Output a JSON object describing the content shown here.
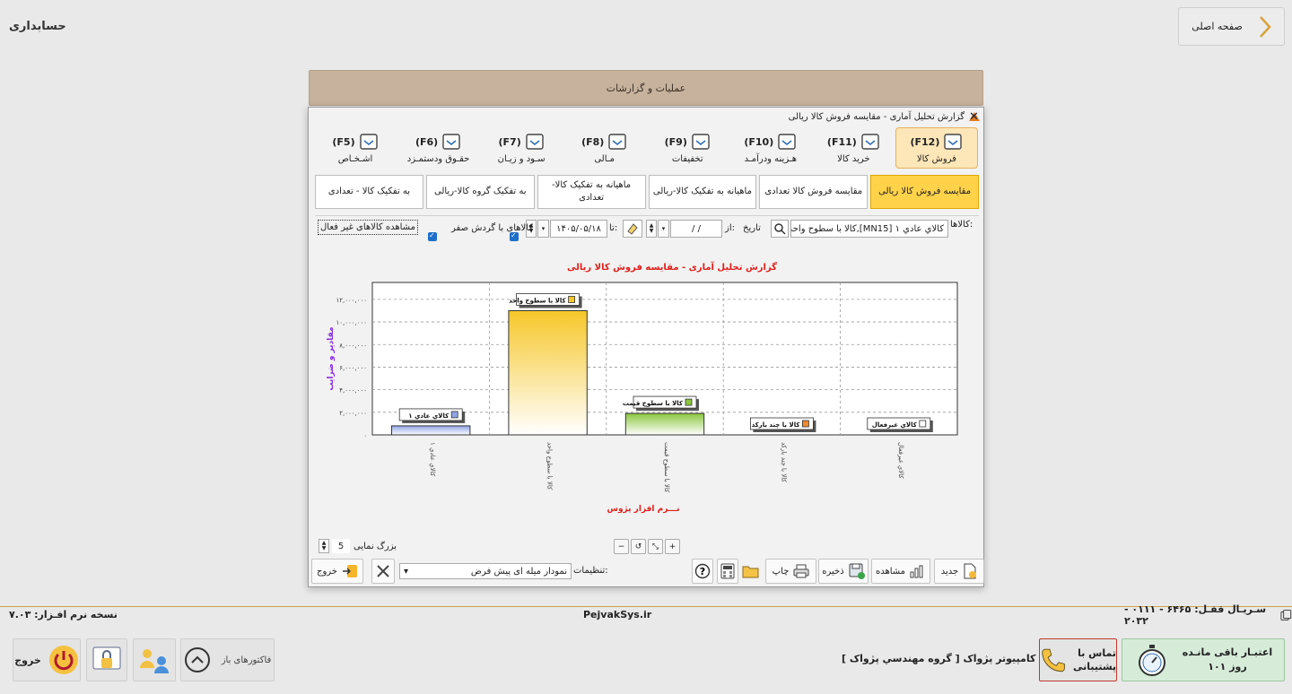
{
  "app": {
    "title": "حسابداری",
    "home_label": "صفحه اصلی",
    "ops_label": "عملیات و گزارشات"
  },
  "dialog": {
    "title": "گزارش تحلیل آماری - مقایسه فروش کالا ریالی",
    "function_tabs": [
      {
        "key": "(F12)",
        "label": "فروش کالا",
        "icon": "sell-goods-icon",
        "active": true
      },
      {
        "key": "(F11)",
        "label": "خرید کالا",
        "icon": "buy-goods-icon",
        "active": false
      },
      {
        "key": "(F10)",
        "label": "هـزینه ودرآمـد",
        "icon": "expense-income-icon",
        "active": false
      },
      {
        "key": "(F9)",
        "label": "تخفیفات",
        "icon": "discount-icon",
        "active": false
      },
      {
        "key": "(F8)",
        "label": "مـالی",
        "icon": "financial-icon",
        "active": false
      },
      {
        "key": "(F7)",
        "label": "سـود و زیـان",
        "icon": "profit-loss-icon",
        "active": false
      },
      {
        "key": "(F6)",
        "label": "حقـوق ودستمـزد",
        "icon": "payroll-icon",
        "active": false
      },
      {
        "key": "(F5)",
        "label": "اشـخـاص",
        "icon": "persons-icon",
        "active": false
      }
    ],
    "sub_tabs": [
      {
        "label": "مقایسه فروش کالا ریالی",
        "active": true
      },
      {
        "label": "مقایسه فروش کالا تعدادی",
        "active": false
      },
      {
        "label": "ماهیانه به تفکیک کالا-ریالی",
        "active": false
      },
      {
        "label": "ماهیانه به تفکیک کالا-تعدادی",
        "active": false
      },
      {
        "label": "به تفکیک گروه کالا-ریالی",
        "active": false
      },
      {
        "label": "به تفکیک کالا - تعدادی",
        "active": false
      }
    ],
    "filters": {
      "goods_label": "کالاها:",
      "goods_value": "کالاي عادي ۱ [MN15],کالا با سطوح واحد,کالا ب",
      "date_label": "تاریخ",
      "from_label": "از:",
      "from_value": "/ /",
      "to_label": "تا:",
      "to_value": "۱۴۰۵/۰۵/۱۸",
      "zero_turnover_label": "کالاهای با گردش صفر",
      "zero_turnover_checked": true,
      "inactive_label": "مشاهده کالاهای غیر فعال",
      "inactive_checked": true
    },
    "zoom": {
      "label": "بزرگ نمایی",
      "value": "5"
    },
    "toolbar": {
      "exit_label": "خروج",
      "settings_label": "تنظیمات:",
      "settings_value": "نمودار میله ای پیش فرض",
      "print_label": "چاپ",
      "save_label": "ذخیره",
      "view_label": "مشاهده",
      "new_label": "جدید"
    }
  },
  "chart_data": {
    "type": "bar",
    "title": "گزارش تحلیل آماری - مقایسه فروش کالا ریالی",
    "ylabel": "مقادیر و ضرایب",
    "xlabel": "نـــرم افزار پژوس",
    "ylim": [
      0,
      13500000
    ],
    "yticks": [
      0,
      2000000,
      4000000,
      6000000,
      8000000,
      10000000,
      12000000
    ],
    "ytick_labels": [
      "۰",
      "۲,۰۰۰,۰۰۰",
      "۴,۰۰۰,۰۰۰",
      "۶,۰۰۰,۰۰۰",
      "۸,۰۰۰,۰۰۰",
      "۱۰,۰۰۰,۰۰۰",
      "۱۲,۰۰۰,۰۰۰"
    ],
    "grid": true,
    "categories": [
      "كالاي عادي ۱",
      "كالا با سطوح واحد",
      "كالا با سطوح قيمت",
      "كالا با چند باركد",
      "كالاي غيرفعال"
    ],
    "values": [
      800000,
      11000000,
      1900000,
      0,
      0
    ],
    "colors": [
      "#8fa3e6",
      "#f6c72a",
      "#8cc63e",
      "#f08a2c",
      "#ffffff"
    ],
    "legend_labels": [
      "كالاي عادي ۱",
      "كالا با سطوح واحد",
      "كالا با سطوح قيمت",
      "كالا با چند باركد",
      "كالاي غيرفعال"
    ]
  },
  "status": {
    "version": "نسخه نرم افـزار: ۷.۰۳",
    "site": "PejvakSys.ir",
    "serial": "سـريـال قفـل:  ۶۴۶۵ - ۰۱۱۱ - ۲۰۳۲"
  },
  "bottom": {
    "exit_label": "خروج",
    "open_factors_label": "فاکتورهای باز",
    "company": "شرکت مهندسي کامپيوتر پژواک [ گروه مهندسي پژواک ]",
    "support_label": "تماس با پشتیبانی",
    "credit_label": "اعتبـار باقی مانـده",
    "credit_days": "۱۰۱ روز"
  },
  "colors": {
    "accent": "#ffd24a",
    "active_tab_bg": "#fde6b8",
    "ops_bar": "#c6b29d",
    "chart_title": "#e0201b",
    "y_label": "#8a2be2"
  }
}
